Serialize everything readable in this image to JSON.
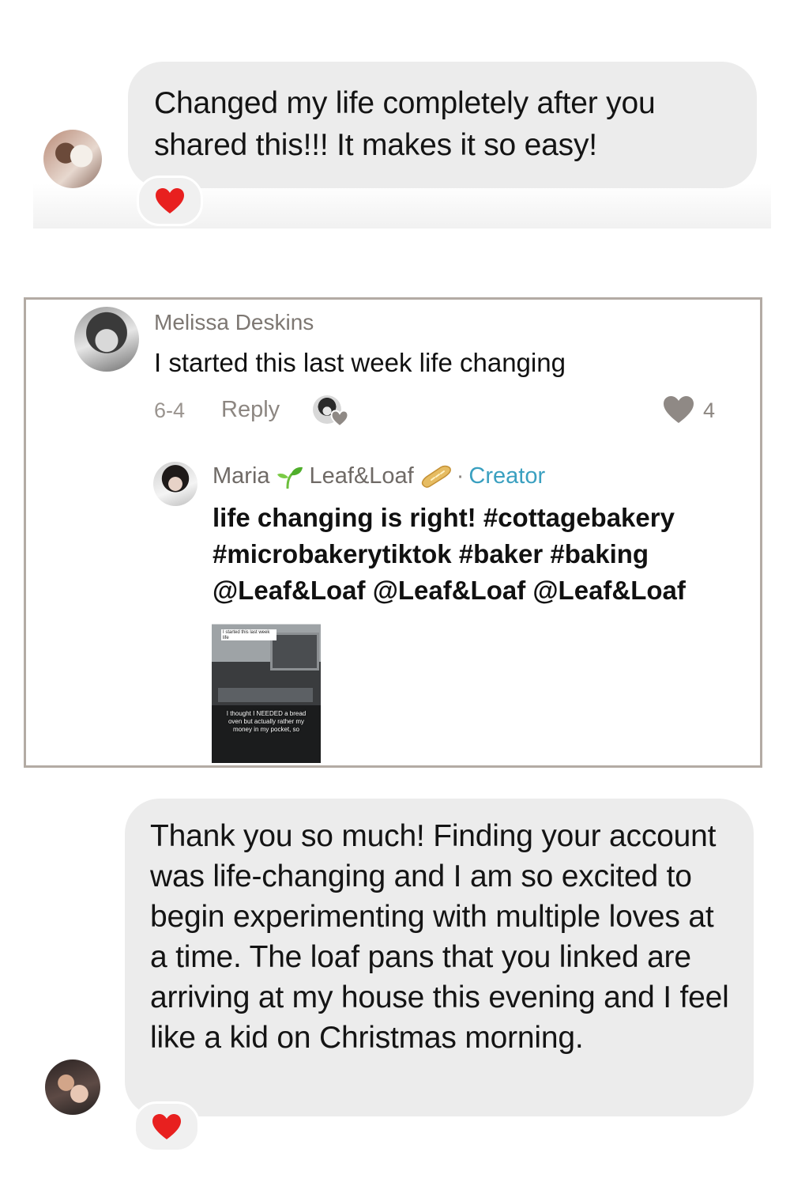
{
  "messages": [
    {
      "text": "Changed my life completely after you shared this!!! It makes it so easy!",
      "reaction": "heart"
    },
    {
      "text": "Thank you so much! Finding your account was life-changing and I am so excited to begin experimenting with multiple loves at a time. The loaf pans that you linked are arriving at my house this evening and I feel like a kid on Christmas morning.",
      "reaction": "heart"
    }
  ],
  "comment": {
    "author": "Melissa Deskins",
    "text": "I started this last week life changing",
    "date": "6-4",
    "reply_label": "Reply",
    "like_count": "4",
    "reply": {
      "author_first": "Maria",
      "author_brand": "Leaf&Loaf",
      "separator": "·",
      "badge": "Creator",
      "lines": [
        "life changing is right! #cottagebakery",
        "#microbakerytiktok #baker #baking",
        "@Leaf&Loaf  @Leaf&Loaf  @Leaf&Loaf"
      ],
      "thumbnail": {
        "label": "I started this last week life",
        "caption": "I thought I NEEDED a bread oven but actually rather my money in my pocket, so"
      }
    }
  },
  "colors": {
    "bubble": "#ececec",
    "heart": "#e8201f",
    "card_border": "#b3aba4",
    "creator_badge": "#3aa0c0",
    "muted_text": "#8c8681"
  }
}
